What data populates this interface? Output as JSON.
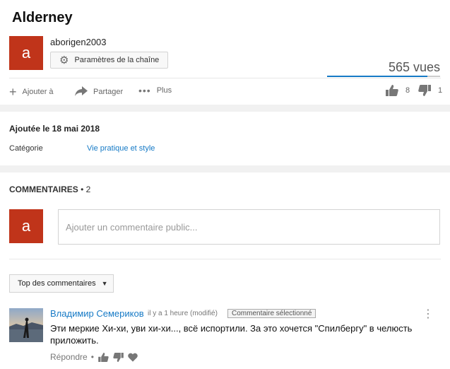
{
  "video": {
    "title": "Alderney",
    "channel_avatar_letter": "a",
    "channel_name": "aborigen2003",
    "settings_label": "Paramètres de la chaîne",
    "views": "565 vues",
    "view_bar_fraction": 0.89,
    "actions": {
      "add": "Ajouter à",
      "share": "Partager",
      "more": "Plus"
    },
    "likes": "8",
    "dislikes": "1"
  },
  "info": {
    "date": "Ajoutée le 18 mai 2018",
    "category_label": "Catégorie",
    "category_value": "Vie pratique et style"
  },
  "comments": {
    "header": "COMMENTAIRES",
    "count": "• 2",
    "user_avatar_letter": "a",
    "input_placeholder": "Ajouter un commentaire public...",
    "sort_label": "Top des commentaires",
    "items": [
      {
        "author": "Владимир Семериков",
        "time": "il y a 1 heure (modifié)",
        "badge": "Commentaire sélectionné",
        "text": "Эти меркие Хи-хи, уви хи-хи..., всё испортили. За это хочется \"Спилбергу\" в челюсть приложить.",
        "reply": "Répondre",
        "separator": "•"
      }
    ]
  },
  "colors": {
    "avatar": "#c0341a",
    "link": "#167ac6"
  }
}
